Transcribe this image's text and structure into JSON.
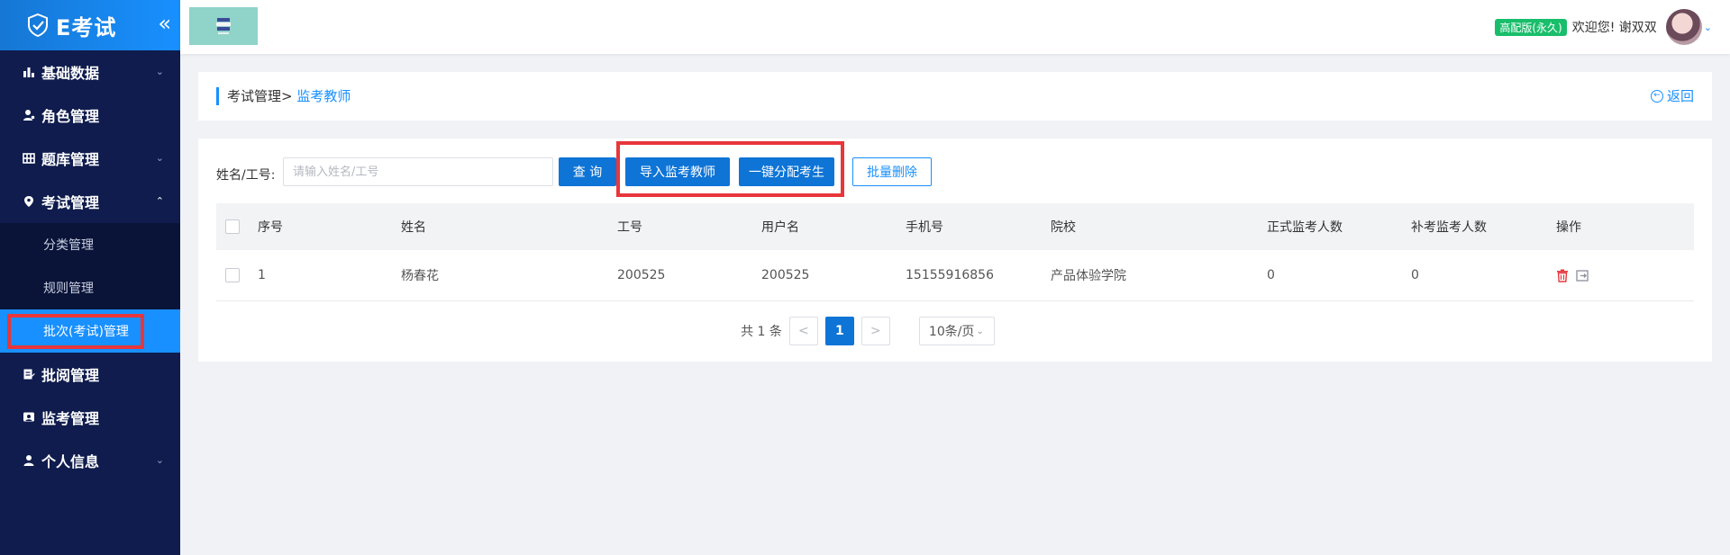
{
  "sidebar": {
    "logo_text": "E考试",
    "collapse_glyph": "«",
    "menu": [
      {
        "label": "基础数据",
        "icon": "bar-chart-icon",
        "arrow": "⌄"
      },
      {
        "label": "角色管理",
        "icon": "user-role-icon",
        "arrow": ""
      },
      {
        "label": "题库管理",
        "icon": "grid-icon",
        "arrow": "⌄"
      },
      {
        "label": "考试管理",
        "icon": "location-pin-icon",
        "arrow": "⌃"
      }
    ],
    "submenu": [
      {
        "label": "分类管理"
      },
      {
        "label": "规则管理"
      },
      {
        "label": "批次(考试)管理",
        "active": true
      }
    ],
    "menu2": [
      {
        "label": "批阅管理",
        "icon": "edit-doc-icon",
        "arrow": ""
      },
      {
        "label": "监考管理",
        "icon": "monitor-icon",
        "arrow": ""
      },
      {
        "label": "个人信息",
        "icon": "person-icon",
        "arrow": "⌄"
      }
    ]
  },
  "header": {
    "badge": "高配版(永久)",
    "welcome": "欢迎您! 谢双双",
    "caret": "⌄"
  },
  "breadcrumb": {
    "parent": "考试管理>",
    "current": "监考教师",
    "back_label": "返回"
  },
  "filter": {
    "label": "姓名/工号:",
    "placeholder": "请输入姓名/工号",
    "value": "",
    "search_button": "查 询",
    "import_button": "导入监考教师",
    "assign_button": "一键分配考生",
    "batch_delete_button": "批量删除"
  },
  "table": {
    "columns": [
      "序号",
      "姓名",
      "工号",
      "用户名",
      "手机号",
      "院校",
      "正式监考人数",
      "补考监考人数",
      "操作"
    ],
    "rows": [
      {
        "index": "1",
        "name": "杨春花",
        "job_no": "200525",
        "username": "200525",
        "phone": "15155916856",
        "school": "产品体验学院",
        "formal_count": "0",
        "makeup_count": "0"
      }
    ]
  },
  "pagination": {
    "total": "共 1 条",
    "prev": "<",
    "current_page": "1",
    "next": ">",
    "page_size": "10条/页"
  },
  "colors": {
    "sidebar_bg": "#0f1c4d",
    "primary": "#1890ff",
    "button_primary": "#0e74d6",
    "highlight_red": "#e8363b",
    "badge_green": "#19be6b"
  }
}
